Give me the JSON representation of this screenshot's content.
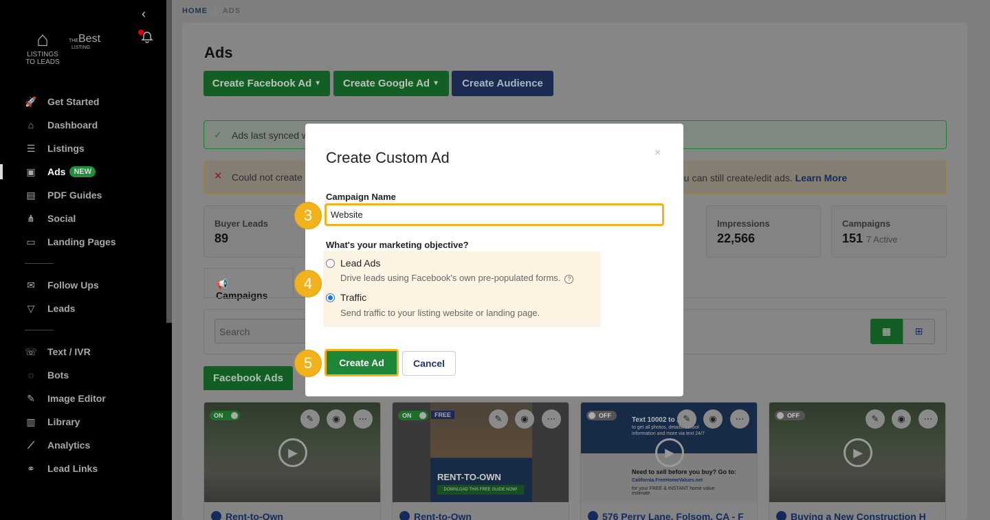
{
  "sidebar": {
    "logo": {
      "line1": "LISTINGS",
      "line2": "TO LEADS",
      "brand2_small": "THE",
      "brand2": "Best",
      "brand2_sub": "LISTING"
    },
    "group1": [
      {
        "label": "Get Started",
        "icon": "rocket-icon"
      },
      {
        "label": "Dashboard",
        "icon": "home-icon"
      },
      {
        "label": "Listings",
        "icon": "list-icon"
      },
      {
        "label": "Ads",
        "icon": "ad-icon",
        "badge": "NEW",
        "active": true
      },
      {
        "label": "PDF Guides",
        "icon": "pdf-icon"
      },
      {
        "label": "Social",
        "icon": "share-icon"
      },
      {
        "label": "Landing Pages",
        "icon": "page-icon"
      }
    ],
    "group2": [
      {
        "label": "Follow Ups",
        "icon": "mail-icon"
      },
      {
        "label": "Leads",
        "icon": "filter-icon"
      }
    ],
    "group3": [
      {
        "label": "Text / IVR",
        "icon": "chat-icon"
      },
      {
        "label": "Bots",
        "icon": "bot-icon"
      },
      {
        "label": "Image Editor",
        "icon": "brush-icon"
      },
      {
        "label": "Library",
        "icon": "library-icon"
      },
      {
        "label": "Analytics",
        "icon": "chart-icon"
      },
      {
        "label": "Lead Links",
        "icon": "link-icon"
      }
    ]
  },
  "breadcrumb": {
    "home": "HOME",
    "sep": "/",
    "current": "ADS"
  },
  "page": {
    "title": "Ads",
    "buttons": {
      "facebook": "Create Facebook Ad",
      "google": "Create Google Ad",
      "audience": "Create Audience"
    },
    "alert_ok": "Ads last synced w",
    "alert_err": {
      "text_start": "Could not create",
      "text_end": "ou can still create/edit ads.",
      "link": "Learn More"
    },
    "stats": [
      {
        "label": "Buyer Leads",
        "value": "89"
      },
      {
        "label": "Impressions",
        "value": "22,566"
      },
      {
        "label": "Campaigns",
        "value": "151",
        "sub": "7 Active"
      }
    ],
    "tab": "Campaigns",
    "search_placeholder": "Search",
    "fb_tab": "Facebook Ads",
    "cards": [
      {
        "status": "ON",
        "title": "Rent-to-Own"
      },
      {
        "status": "ON",
        "badge": "FREE",
        "title": "Rent-to-Own",
        "poster_title": "RENT-TO-OWN",
        "poster_cta": "DOWNLOAD THIS FREE GUIDE NOW!"
      },
      {
        "status": "OFF",
        "title": "576 Perry Lane, Folsom, CA - F",
        "info1": "Text 10002 to 2",
        "info2": "to get all photos, details, school information and more via text 24/7",
        "info3": "Need to sell before you buy? Go to:",
        "info4": "California.FreeHomeValues.net",
        "info5": "for your FREE & INSTANT home value estimate."
      },
      {
        "status": "OFF",
        "title": "Buying a New Construction H"
      }
    ]
  },
  "modal": {
    "title": "Create Custom Ad",
    "close": "×",
    "campaign_label": "Campaign Name",
    "campaign_value": "Website",
    "objective_label": "What's your marketing objective?",
    "options": [
      {
        "label": "Lead Ads",
        "desc": "Drive leads using Facebook's own pre-populated forms.",
        "checked": false
      },
      {
        "label": "Traffic",
        "desc": "Send traffic to your listing website or landing page.",
        "checked": true
      }
    ],
    "create": "Create Ad",
    "cancel": "Cancel"
  },
  "steps": [
    "3",
    "4",
    "5"
  ],
  "colors": {
    "accent_green": "#1e8737",
    "highlight": "#f1b21c",
    "navy": "#1b3570",
    "radio_blue": "#1a73e8"
  }
}
